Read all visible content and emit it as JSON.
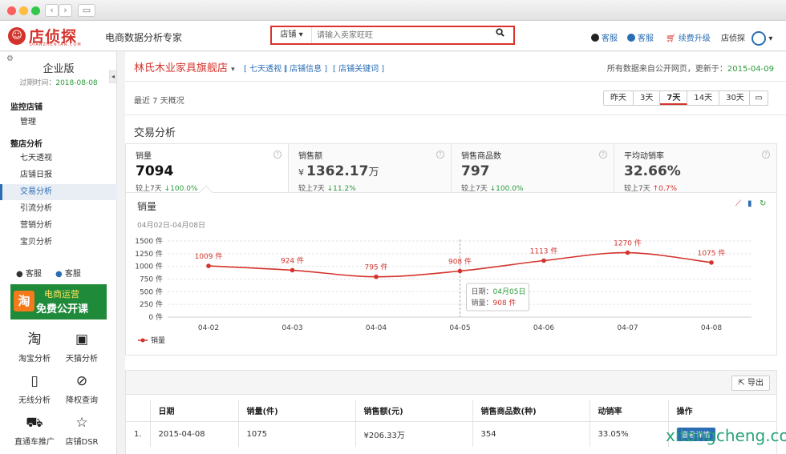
{
  "header": {
    "brand": "店侦探",
    "brand_sub": "DIANZHENTAN.COM",
    "tagline": "电商数据分析专家",
    "search_category": "店铺",
    "search_placeholder": "请输入卖家旺旺",
    "links": [
      "客服",
      "客服",
      "续费升级",
      "店侦探"
    ]
  },
  "sidebar": {
    "edition": "企业版",
    "expire_label": "过期时间：",
    "expire_date": "2018-08-08",
    "section1": "监控店铺",
    "section1_items": [
      "管理"
    ],
    "section2": "整店分析",
    "section2_items": [
      "七天透视",
      "店铺日报",
      "交易分析",
      "引流分析",
      "营销分析",
      "宝贝分析"
    ],
    "active_item": "交易分析",
    "service": [
      "客服",
      "客服"
    ],
    "promo": {
      "line1": "电商运营",
      "line2": "免费公开课",
      "badge": "淘"
    },
    "tools": [
      "淘宝分析",
      "天猫分析",
      "无线分析",
      "降权查询",
      "直通车推广",
      "店铺DSR"
    ]
  },
  "main": {
    "shop_name": "林氏木业家具旗舰店",
    "shop_links": [
      "[ 七天透视 ]",
      "[ 店铺信息 ]",
      "[ 店铺关键词 ]"
    ],
    "update_prefix": "所有数据来自公开网页，更新于：",
    "update_date": "2015-04-09",
    "recent": "最近 7 天概况",
    "ranges": [
      "昨天",
      "3天",
      "7天",
      "14天",
      "30天"
    ],
    "range_selected": "7天",
    "section_title": "交易分析",
    "kpis": [
      {
        "label": "销量",
        "value": "7094",
        "cmp_prefix": "较上7天",
        "change": "100.0%",
        "dir": "up"
      },
      {
        "label": "销售额",
        "currency": "¥",
        "value": "1362.17",
        "unit": "万",
        "cmp_prefix": "较上7天",
        "change": "11.2%",
        "dir": "up"
      },
      {
        "label": "销售商品数",
        "value": "797",
        "cmp_prefix": "较上7天",
        "change": "100.0%",
        "dir": "up"
      },
      {
        "label": "平均动销率",
        "value": "32.66%",
        "cmp_prefix": "较上7天",
        "change": "0.7%",
        "dir": "down"
      }
    ],
    "chart_title": "销量",
    "chart_range": "04月02日-04月08日",
    "tooltip": {
      "date_label": "日期：",
      "date": "04月05日",
      "value_label": "销量：",
      "value": "908 件"
    },
    "table": {
      "export": "导出",
      "headers": [
        "日期",
        "销量(件)",
        "销售额(元)",
        "销售商品数(种)",
        "动销率",
        "操作"
      ],
      "rows": [
        {
          "idx": "1.",
          "date": "2015-04-08",
          "qty": "1075",
          "amount": "¥206.33万",
          "items": "354",
          "rate": "33.05%",
          "op": "查看详情"
        }
      ]
    },
    "watermark": "xitongcheng.com"
  },
  "colors": {
    "accent": "#d4332c",
    "link": "#2a6db3",
    "up": "#2a9b3a"
  },
  "chart_data": {
    "type": "line",
    "categories": [
      "04-02",
      "04-03",
      "04-04",
      "04-05",
      "04-06",
      "04-07",
      "04-08"
    ],
    "series": [
      {
        "name": "销量",
        "values": [
          1009,
          924,
          795,
          908,
          1113,
          1270,
          1075
        ]
      }
    ],
    "data_labels": [
      "1009 件",
      "924 件",
      "795 件",
      "908 件",
      "1113 件",
      "1270 件",
      "1075 件"
    ],
    "y_ticks": [
      "0 件",
      "250 件",
      "500 件",
      "750 件",
      "1000 件",
      "1250 件",
      "1500 件"
    ],
    "ylim": [
      0,
      1500
    ],
    "grid": true,
    "legend": "bottom-left",
    "color": "#d4332c"
  }
}
